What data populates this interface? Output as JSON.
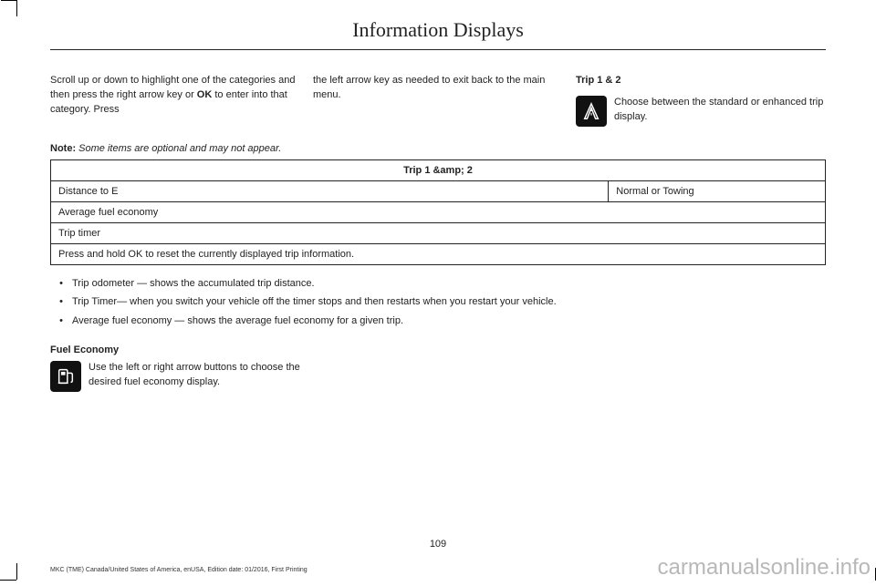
{
  "header": {
    "title": "Information Displays"
  },
  "intro": {
    "col1": "Scroll up or down to highlight one of the categories and then press the right arrow key or ",
    "col1_bold": "OK",
    "col1_after": " to enter into that category. Press",
    "col2": "the left arrow key as needed to exit back to the main menu.",
    "col3_heading": "Trip 1 & 2",
    "col3_text": "Choose between the standard or enhanced trip display."
  },
  "note": {
    "label": "Note:",
    "text": " Some items are optional and may not appear."
  },
  "table": {
    "header": "Trip 1 &amp; 2",
    "rows": [
      [
        "Distance to E",
        "Normal or Towing"
      ],
      [
        "Average fuel economy"
      ],
      [
        "Trip timer"
      ],
      [
        "Press and hold OK to reset the currently displayed trip information."
      ]
    ]
  },
  "bullets": [
    "Trip odometer — shows the accumulated trip distance.",
    "Trip Timer— when you switch your vehicle off the timer stops and then restarts when you restart your vehicle.",
    "Average fuel economy — shows the average fuel economy for a given trip."
  ],
  "fuel": {
    "heading": "Fuel Economy",
    "text": "Use the left or right arrow buttons to choose the desired fuel economy display."
  },
  "footer": {
    "page": "109",
    "imprint": "MKC (TME) Canada/United States of America, enUSA, Edition date: 01/2016, First Printing",
    "watermark": "carmanualsonline.info"
  }
}
